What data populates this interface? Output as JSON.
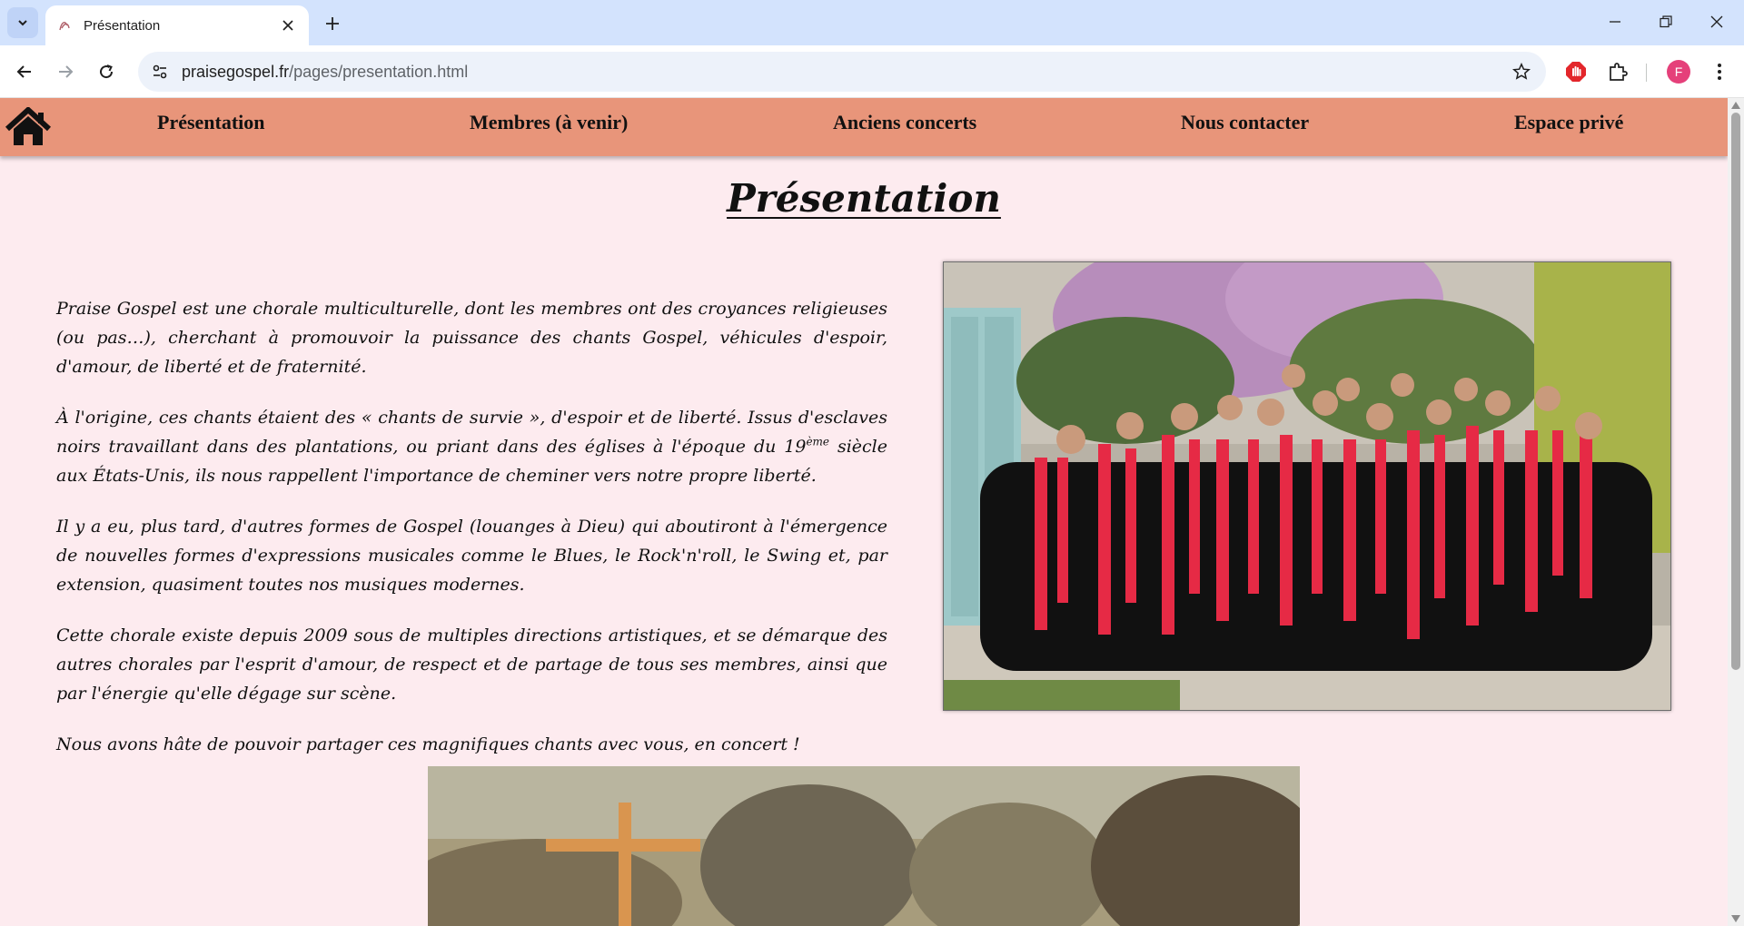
{
  "browser": {
    "tab_title": "Présentation",
    "url_host": "praisegospel.fr",
    "url_path": "/pages/presentation.html",
    "profile_initial": "F",
    "accent": "#d3e3fd"
  },
  "nav": {
    "items": [
      {
        "label": "Présentation"
      },
      {
        "label": "Membres (à venir)"
      },
      {
        "label": "Anciens concerts"
      },
      {
        "label": "Nous contacter"
      },
      {
        "label": "Espace privé"
      }
    ],
    "background": "#e8957a"
  },
  "page": {
    "title": "Présentation",
    "paragraphs": {
      "p1": "Praise Gospel est une chorale multiculturelle, dont les membres ont des croyances religieuses (ou pas…), cherchant à promouvoir la puissance des chants Gospel, véhicules d'espoir, d'amour, de liberté et de fraternité.",
      "p2_before": "À l'origine, ces chants étaient des « chants de survie », d'espoir et de liberté. Issus d'esclaves noirs travaillant dans des plantations, ou priant dans des églises à l'époque du 19",
      "p2_sup": "ème",
      "p2_after": " siècle aux États-Unis, ils nous rappellent l'importance de cheminer vers notre propre liberté.",
      "p3": "Il y a eu, plus tard, d'autres formes de Gospel (louanges à Dieu) qui aboutiront à l'émergence de nouvelles formes d'expressions musicales comme le Blues, le Rock'n'roll, le Swing et, par extension, quasiment toutes nos musiques modernes.",
      "p4": "Cette chorale existe depuis 2009 sous de multiples directions artistiques, et se démarque des autres chorales par l'esprit d'amour, de respect et de partage de tous ses membres, ainsi que par l'énergie qu'elle dégage sur scène.",
      "p5": "Nous avons hâte de pouvoir partager ces magnifiques chants avec vous, en concert !"
    },
    "background": "#fdebef"
  },
  "icons": [
    "chevron-down-icon",
    "tab-favicon-icon",
    "close-icon",
    "plus-icon",
    "minimize-icon",
    "restore-icon",
    "close-window-icon",
    "back-icon",
    "forward-icon",
    "reload-icon",
    "site-info-icon",
    "star-icon",
    "adblock-icon",
    "extensions-icon",
    "more-icon",
    "home-icon"
  ]
}
